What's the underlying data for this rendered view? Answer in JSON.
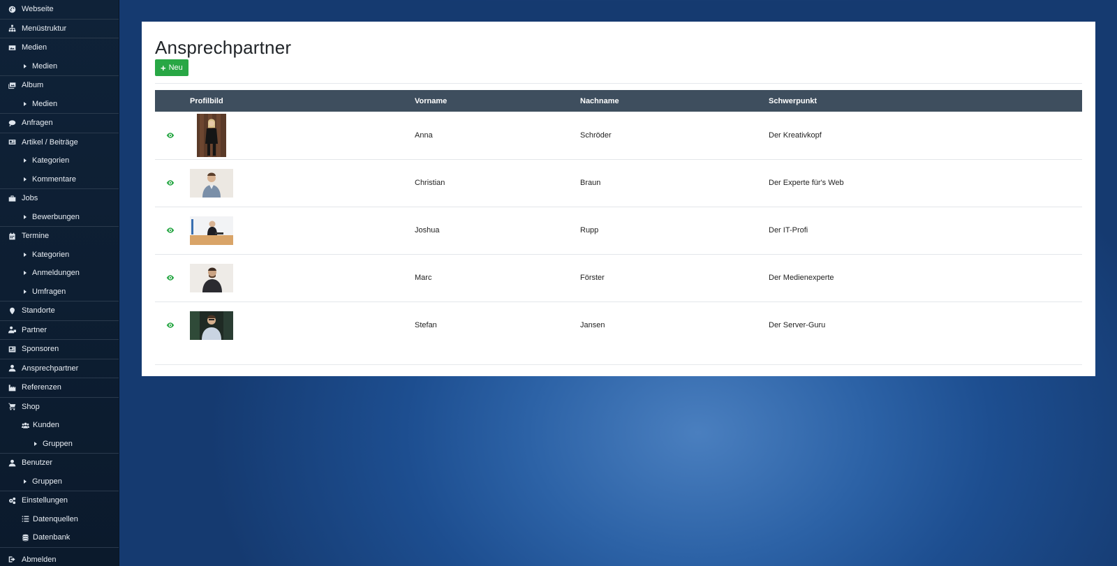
{
  "sidebar": {
    "items": [
      {
        "label": "Webseite",
        "icon": "globe-icon",
        "level": 0
      },
      {
        "label": "Menüstruktur",
        "icon": "sitemap-icon",
        "level": 0
      },
      {
        "label": "Medien",
        "icon": "image-icon",
        "level": 0
      },
      {
        "label": "Medien",
        "icon": "caret-right-icon",
        "level": 1
      },
      {
        "label": "Album",
        "icon": "images-icon",
        "level": 0
      },
      {
        "label": "Medien",
        "icon": "caret-right-icon",
        "level": 1
      },
      {
        "label": "Anfragen",
        "icon": "comment-icon",
        "level": 0
      },
      {
        "label": "Artikel / Beiträge",
        "icon": "newspaper-icon",
        "level": 0
      },
      {
        "label": "Kategorien",
        "icon": "caret-right-icon",
        "level": 1
      },
      {
        "label": "Kommentare",
        "icon": "caret-right-icon",
        "level": 1
      },
      {
        "label": "Jobs",
        "icon": "briefcase-icon",
        "level": 0
      },
      {
        "label": "Bewerbungen",
        "icon": "caret-right-icon",
        "level": 1
      },
      {
        "label": "Termine",
        "icon": "calendar-icon",
        "level": 0
      },
      {
        "label": "Kategorien",
        "icon": "caret-right-icon",
        "level": 1
      },
      {
        "label": "Anmeldungen",
        "icon": "caret-right-icon",
        "level": 1
      },
      {
        "label": "Umfragen",
        "icon": "caret-right-icon",
        "level": 1
      },
      {
        "label": "Standorte",
        "icon": "map-marker-icon",
        "level": 0
      },
      {
        "label": "Partner",
        "icon": "user-tie-icon",
        "level": 0
      },
      {
        "label": "Sponsoren",
        "icon": "ad-icon",
        "level": 0
      },
      {
        "label": "Ansprechpartner",
        "icon": "user-icon",
        "level": 0
      },
      {
        "label": "Referenzen",
        "icon": "industry-icon",
        "level": 0
      },
      {
        "label": "Shop",
        "icon": "shopping-cart-icon",
        "level": 0
      },
      {
        "label": "Kunden",
        "icon": "users-icon",
        "level": 1
      },
      {
        "label": "Gruppen",
        "icon": "caret-right-icon",
        "level": 2
      },
      {
        "label": "Benutzer",
        "icon": "user-icon",
        "level": 0
      },
      {
        "label": "Gruppen",
        "icon": "caret-right-icon",
        "level": 1
      },
      {
        "label": "Einstellungen",
        "icon": "cogs-icon",
        "level": 0
      },
      {
        "label": "Datenquellen",
        "icon": "list-icon",
        "level": 1
      },
      {
        "label": "Datenbank",
        "icon": "database-icon",
        "level": 1
      },
      {
        "label": "Abmelden",
        "icon": "sign-out-icon",
        "level": 0
      }
    ]
  },
  "page": {
    "title": "Ansprechpartner",
    "new_button_label": "Neu"
  },
  "table": {
    "columns": [
      "",
      "Profilbild",
      "Vorname",
      "Nachname",
      "Schwerpunkt"
    ],
    "rows": [
      {
        "vorname": "Anna",
        "nachname": "Schröder",
        "schwerpunkt": "Der Kreativkopf",
        "photo": "portrait"
      },
      {
        "vorname": "Christian",
        "nachname": "Braun",
        "schwerpunkt": "Der Experte für's Web",
        "photo": "landscape-light"
      },
      {
        "vorname": "Joshua",
        "nachname": "Rupp",
        "schwerpunkt": "Der IT-Profi",
        "photo": "landscape-desk"
      },
      {
        "vorname": "Marc",
        "nachname": "Förster",
        "schwerpunkt": "Der Medienexperte",
        "photo": "landscape-light"
      },
      {
        "vorname": "Stefan",
        "nachname": "Jansen",
        "schwerpunkt": "Der Server-Guru",
        "photo": "landscape-dark"
      }
    ]
  },
  "colors": {
    "accent_green": "#28a745",
    "table_header": "#3e4e5e",
    "sidebar_bg": "#0f2238"
  }
}
